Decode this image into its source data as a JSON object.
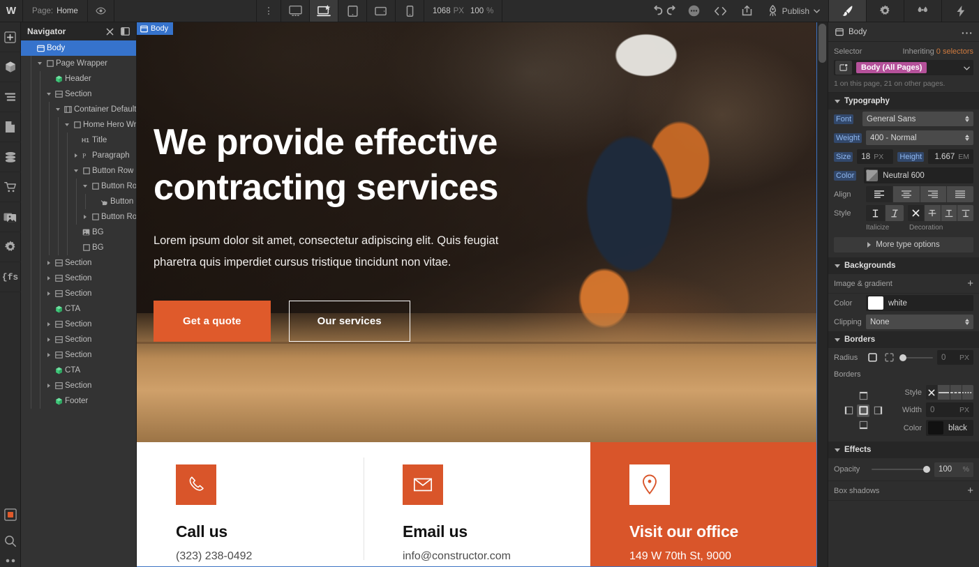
{
  "topbar": {
    "logo": "W",
    "page_label": "Page:",
    "page_value": "Home",
    "canvas_width": "1068",
    "canvas_width_unit": "PX",
    "zoom_value": "100",
    "zoom_unit": "%",
    "publish_label": "Publish",
    "icons": {
      "preview": "eye-icon",
      "more": "kebab-menu-icon",
      "desktop": "desktop-breakpoint-icon",
      "laptop": "laptop-breakpoint-icon",
      "tablet": "tablet-breakpoint-icon",
      "tablet_landscape": "tablet-landscape-breakpoint-icon",
      "mobile": "mobile-breakpoint-icon",
      "undo": "undo-icon",
      "redo": "redo-icon",
      "comments": "comments-icon",
      "code": "code-export-icon",
      "share": "share-icon",
      "rocket": "rocket-icon"
    },
    "panel_tabs": [
      {
        "name": "style-panel-tab",
        "icon": "brush-icon",
        "active": true
      },
      {
        "name": "settings-panel-tab",
        "icon": "gear-icon",
        "active": false
      },
      {
        "name": "interactions-panel-tab",
        "icon": "droplets-icon",
        "active": false
      },
      {
        "name": "effects-panel-tab",
        "icon": "lightning-icon",
        "active": false
      }
    ]
  },
  "rail": {
    "items": [
      {
        "name": "add-elements-button",
        "icon": "plus-icon"
      },
      {
        "name": "components-button",
        "icon": "cube-icon"
      },
      {
        "name": "navigator-button",
        "icon": "layers-icon"
      },
      {
        "name": "pages-button",
        "icon": "page-icon"
      },
      {
        "name": "cms-button",
        "icon": "database-icon"
      },
      {
        "name": "ecommerce-button",
        "icon": "cart-icon"
      },
      {
        "name": "assets-button",
        "icon": "images-icon"
      },
      {
        "name": "settings-button",
        "icon": "gear-icon"
      },
      {
        "name": "variables-button",
        "icon": "fs-braces-icon"
      }
    ],
    "bottom": [
      {
        "name": "selected-tool-button",
        "icon": "orange-square-icon"
      },
      {
        "name": "search-button",
        "icon": "magnifier-icon"
      },
      {
        "name": "more-button",
        "icon": "dots-icon"
      }
    ]
  },
  "navigator": {
    "title": "Navigator",
    "close_icon": "close-x-icon",
    "collapse_icon": "panel-collapse-icon",
    "tree": [
      {
        "label": "Body",
        "depth": 0,
        "icon": "body-icon",
        "arrow": "none",
        "selected": true
      },
      {
        "label": "Page Wrapper",
        "depth": 1,
        "icon": "div-icon",
        "arrow": "open",
        "selected": false
      },
      {
        "label": "Header",
        "depth": 2,
        "icon": "component-icon",
        "arrow": "none",
        "selected": false
      },
      {
        "label": "Section",
        "depth": 2,
        "icon": "section-icon",
        "arrow": "open",
        "selected": false
      },
      {
        "label": "Container Default",
        "depth": 3,
        "icon": "container-icon",
        "arrow": "open",
        "selected": false
      },
      {
        "label": "Home Hero Wrapper",
        "depth": 4,
        "icon": "div-icon",
        "arrow": "open",
        "selected": false
      },
      {
        "label": "Title",
        "depth": 5,
        "icon": "h1-icon",
        "arrow": "none",
        "selected": false
      },
      {
        "label": "Paragraph",
        "depth": 5,
        "icon": "paragraph-icon",
        "arrow": "closed",
        "selected": false
      },
      {
        "label": "Button Row",
        "depth": 5,
        "icon": "div-icon",
        "arrow": "open",
        "selected": false
      },
      {
        "label": "Button Row First",
        "depth": 6,
        "icon": "div-icon",
        "arrow": "open",
        "selected": false
      },
      {
        "label": "Button Primary",
        "depth": 7,
        "icon": "link-icon",
        "arrow": "none",
        "selected": false
      },
      {
        "label": "Button Row Last",
        "depth": 6,
        "icon": "div-icon",
        "arrow": "closed",
        "selected": false
      },
      {
        "label": "BG",
        "depth": 5,
        "icon": "image-icon",
        "arrow": "none",
        "selected": false
      },
      {
        "label": "BG",
        "depth": 5,
        "icon": "div-icon",
        "arrow": "none",
        "selected": false
      },
      {
        "label": "Section",
        "depth": 2,
        "icon": "section-icon",
        "arrow": "closed",
        "selected": false
      },
      {
        "label": "Section",
        "depth": 2,
        "icon": "section-icon",
        "arrow": "closed",
        "selected": false
      },
      {
        "label": "Section",
        "depth": 2,
        "icon": "section-icon",
        "arrow": "closed",
        "selected": false
      },
      {
        "label": "CTA",
        "depth": 2,
        "icon": "component-icon",
        "arrow": "none",
        "selected": false
      },
      {
        "label": "Section",
        "depth": 2,
        "icon": "section-icon",
        "arrow": "closed",
        "selected": false
      },
      {
        "label": "Section",
        "depth": 2,
        "icon": "section-icon",
        "arrow": "closed",
        "selected": false
      },
      {
        "label": "Section",
        "depth": 2,
        "icon": "section-icon",
        "arrow": "closed",
        "selected": false
      },
      {
        "label": "CTA",
        "depth": 2,
        "icon": "component-icon",
        "arrow": "none",
        "selected": false
      },
      {
        "label": "Section",
        "depth": 2,
        "icon": "section-icon",
        "arrow": "closed",
        "selected": false
      },
      {
        "label": "Footer",
        "depth": 2,
        "icon": "component-icon",
        "arrow": "none",
        "selected": false
      }
    ]
  },
  "canvas": {
    "selected_badge": "Body",
    "hero": {
      "title": "We provide effective contracting services",
      "paragraph": "Lorem ipsum dolor sit amet, consectetur adipiscing elit. Quis feugiat pharetra quis imperdiet cursus tristique tincidunt non vitae.",
      "primary_button": "Get a quote",
      "outline_button": "Our services"
    },
    "contact_cards": [
      {
        "icon": "phone-icon",
        "title": "Call us",
        "value": "(323) 238-0492",
        "style": "light"
      },
      {
        "icon": "envelope-icon",
        "title": "Email us",
        "value": "info@constructor.com",
        "style": "light"
      },
      {
        "icon": "map-pin-icon",
        "title": "Visit our office",
        "value": "149 W 70th St, 9000",
        "style": "orange"
      }
    ]
  },
  "style_panel": {
    "element_name": "Body",
    "element_icon": "body-icon",
    "more_icon": "kebab-menu-icon",
    "selector": {
      "label": "Selector",
      "inheriting_label": "Inheriting",
      "inheriting_count": "0 selectors",
      "chip": "Body (All Pages)",
      "note": "1 on this page, 21 on other pages.",
      "state_icon": "selector-state-icon",
      "caret_icon": "chevron-down-icon"
    },
    "typography": {
      "title": "Typography",
      "font_label": "Font",
      "font_value": "General Sans",
      "weight_label": "Weight",
      "weight_value": "400 - Normal",
      "size_label": "Size",
      "size_value": "18",
      "size_unit": "PX",
      "height_label": "Height",
      "height_value": "1.667",
      "height_unit": "EM",
      "color_label": "Color",
      "color_value": "Neutral 600",
      "color_hex": "#9b9b9b",
      "align_label": "Align",
      "align_options": [
        "align-left-icon",
        "align-center-icon",
        "align-right-icon",
        "align-justify-icon"
      ],
      "align_active": 0,
      "style_label": "Style",
      "italicize_caption": "Italicize",
      "decoration_caption": "Decoration",
      "style_options": [
        "upright-icon",
        "italic-icon"
      ],
      "style_active": 0,
      "decoration_options": [
        "no-decoration-icon",
        "strikethrough-icon",
        "underline-icon",
        "overline-icon"
      ],
      "decoration_active": 0,
      "more_options": "More type options"
    },
    "backgrounds": {
      "title": "Backgrounds",
      "image_gradient_label": "Image & gradient",
      "color_label": "Color",
      "color_value": "white",
      "color_hex": "#ffffff",
      "clipping_label": "Clipping",
      "clipping_value": "None"
    },
    "borders": {
      "title": "Borders",
      "radius_label": "Radius",
      "radius_value": "0",
      "radius_unit": "PX",
      "borders_label": "Borders",
      "style_label": "Style",
      "style_options": [
        "none-x-icon",
        "solid-icon",
        "dashed-icon",
        "dotted-icon"
      ],
      "style_active": 0,
      "width_label": "Width",
      "width_value": "0",
      "width_unit": "PX",
      "color_label": "Color",
      "color_value": "black",
      "color_hex": "#111111"
    },
    "effects": {
      "title": "Effects",
      "opacity_label": "Opacity",
      "opacity_value": "100",
      "opacity_unit": "%",
      "box_shadows_label": "Box shadows"
    }
  },
  "colors": {
    "accent_orange": "#d9552a",
    "selection_blue": "#3673cc",
    "chip_magenta": "#b5519a",
    "inherit_orange": "#d07b3f"
  }
}
